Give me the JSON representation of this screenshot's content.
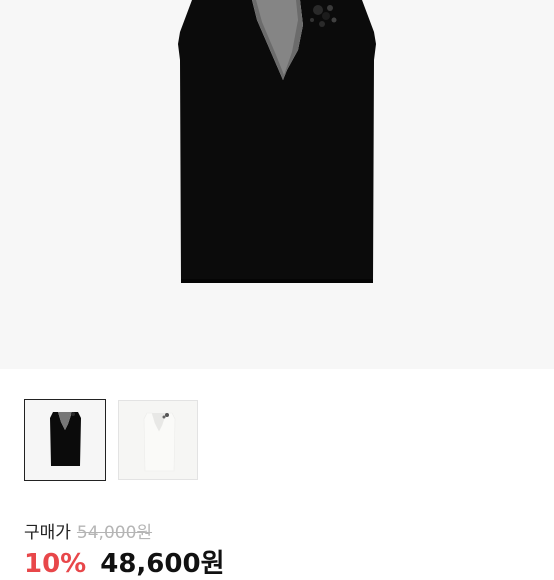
{
  "product": {
    "images": [
      {
        "name": "black-sleeveless-top",
        "selected": true
      },
      {
        "name": "white-sleeveless-top",
        "selected": false
      }
    ],
    "price_label": "구매가",
    "original_price": "54,000원",
    "discount": "10%",
    "sale_price": "48,600원"
  },
  "colors": {
    "background": "#f7f7f7",
    "garment_black": "#0a0a0a",
    "discount_red": "#e8474a",
    "strike_gray": "#b5b5b5"
  }
}
